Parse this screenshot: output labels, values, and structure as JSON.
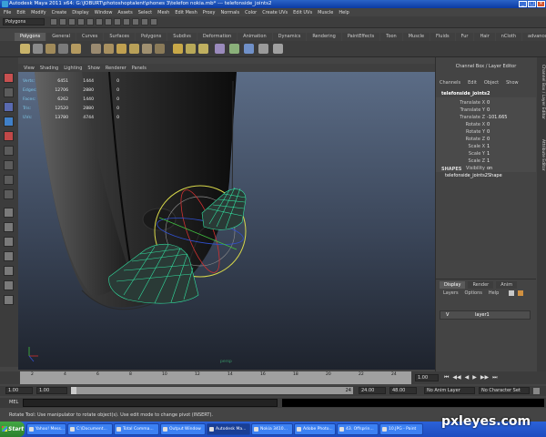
{
  "window": {
    "title": "Autodesk Maya 2011 x64: G:\\JOBURT\\photoshoptalent\\phones 3\\telefon nokia.mb*  ---  telefonside_joints2"
  },
  "menubar": [
    "File",
    "Edit",
    "Modify",
    "Create",
    "Display",
    "Window",
    "Assets",
    "Select",
    "Mesh",
    "Edit Mesh",
    "Proxy",
    "Normals",
    "Color",
    "Create UVs",
    "Edit UVs",
    "Muscle",
    "Help"
  ],
  "status_line": {
    "mode": "Polygons"
  },
  "shelf_tabs": [
    "Polygons",
    "General",
    "Curves",
    "Surfaces",
    "Polygons",
    "Subdivs",
    "Deformation",
    "Animation",
    "Dynamics",
    "Rendering",
    "PaintEffects",
    "Toon",
    "Muscle",
    "Fluids",
    "Fur",
    "Hair",
    "nCloth",
    "advancedSkeleton"
  ],
  "panel_menu": [
    "View",
    "Shading",
    "Lighting",
    "Show",
    "Renderer",
    "Panels"
  ],
  "hud": {
    "rows": [
      {
        "label": "Verts:",
        "c1": "6451",
        "c2": "1444",
        "c3": "0"
      },
      {
        "label": "Edges:",
        "c1": "12706",
        "c2": "2880",
        "c3": "0"
      },
      {
        "label": "Faces:",
        "c1": "6262",
        "c2": "1440",
        "c3": "0"
      },
      {
        "label": "Tris:",
        "c1": "12520",
        "c2": "2880",
        "c3": "0"
      },
      {
        "label": "UVs:",
        "c1": "13780",
        "c2": "4744",
        "c3": "0"
      }
    ]
  },
  "viewport": {
    "camera_label": "persp",
    "wire_color": "#32e0a0",
    "manipulator_color": "#d8d84a"
  },
  "channel_box": {
    "title": "Channel Box / Layer Editor",
    "menu": [
      "Channels",
      "Edit",
      "Object",
      "Show"
    ],
    "node": "telefonside_joints2",
    "attributes": [
      {
        "name": "Translate X",
        "value": "0"
      },
      {
        "name": "Translate Y",
        "value": "0"
      },
      {
        "name": "Translate Z",
        "value": "-101.665"
      },
      {
        "name": "Rotate X",
        "value": "0"
      },
      {
        "name": "Rotate Y",
        "value": "0"
      },
      {
        "name": "Rotate Z",
        "value": "0"
      },
      {
        "name": "Scale X",
        "value": "1"
      },
      {
        "name": "Scale Y",
        "value": "1"
      },
      {
        "name": "Scale Z",
        "value": "1"
      },
      {
        "name": "Visibility",
        "value": "on"
      }
    ],
    "shapes_label": "SHAPES",
    "shape": "telefonside_joints2Shape"
  },
  "layer_editor": {
    "tabs": [
      "Display",
      "Render",
      "Anim"
    ],
    "menu": [
      "Layers",
      "Options",
      "Help"
    ],
    "layer": {
      "visible": "V",
      "name": "layer1"
    }
  },
  "side_tabs": [
    "Channel Box / Layer Editor",
    "Attribute Editor"
  ],
  "time_slider": {
    "ticks": [
      "2",
      "4",
      "6",
      "8",
      "10",
      "12",
      "14",
      "16",
      "18",
      "20",
      "22",
      "24"
    ],
    "current": "1.00"
  },
  "range_slider": {
    "start": "1.00",
    "range_start": "1.00",
    "range_end_label": "24",
    "range_end": "24.00",
    "end": "48.00",
    "anim_layer": "No Anim Layer",
    "character_set": "No Character Set"
  },
  "command_line": {
    "label": "MEL"
  },
  "help_line": "Rotate Tool: Use manipulator to rotate object(s). Use edit mode to change pivot (INSERT).",
  "taskbar": {
    "start": "Start",
    "tasks": [
      {
        "label": "Yahoo! Mess...",
        "active": false
      },
      {
        "label": "C:\\Document...",
        "active": false
      },
      {
        "label": "Total Comma...",
        "active": false
      },
      {
        "label": "Output Window",
        "active": false
      },
      {
        "label": "Autodesk Ma...",
        "active": true
      },
      {
        "label": "Nokia 3410...",
        "active": false
      },
      {
        "label": "Adobe Photo...",
        "active": false
      },
      {
        "label": "43. Offsprin...",
        "active": false
      },
      {
        "label": "10.JPG - Paint",
        "active": false
      }
    ]
  },
  "watermark": "pxleyes.com"
}
